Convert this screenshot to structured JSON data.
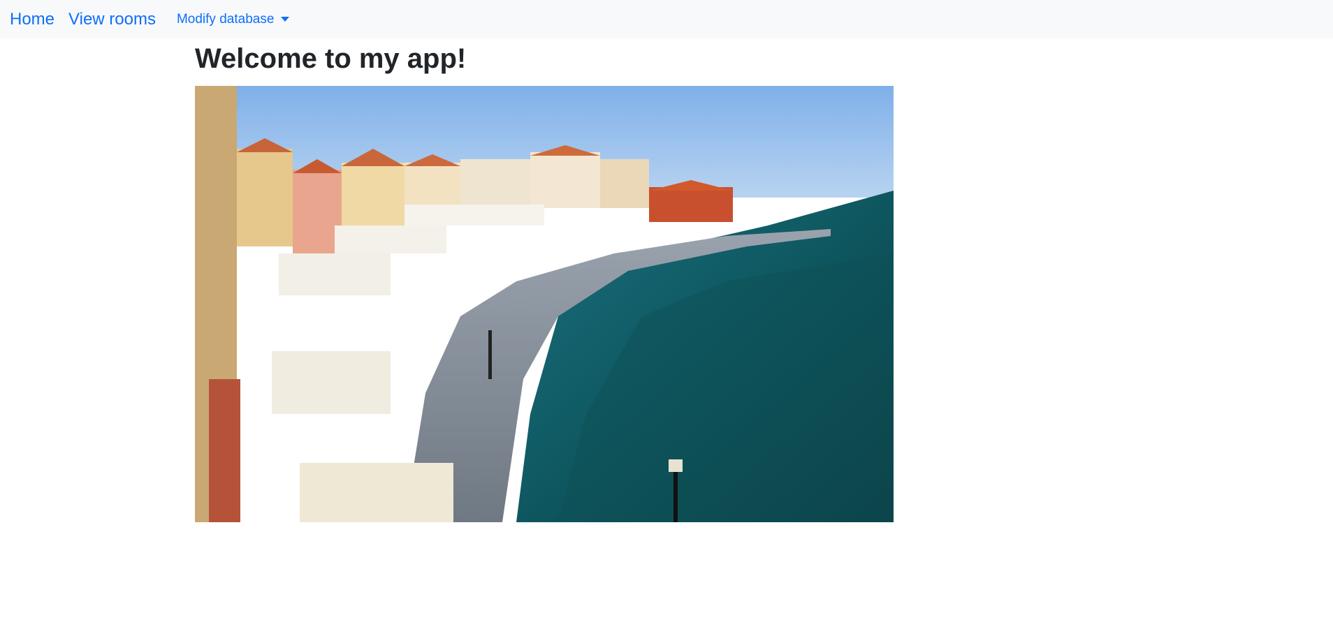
{
  "nav": {
    "home_label": "Home",
    "rooms_label": "View rooms",
    "modify_label": "Modify database"
  },
  "main": {
    "title": "Welcome to my app!"
  },
  "colors": {
    "link": "#0d6efd",
    "navbar_bg": "#f8f9fa",
    "heading": "#212529"
  }
}
